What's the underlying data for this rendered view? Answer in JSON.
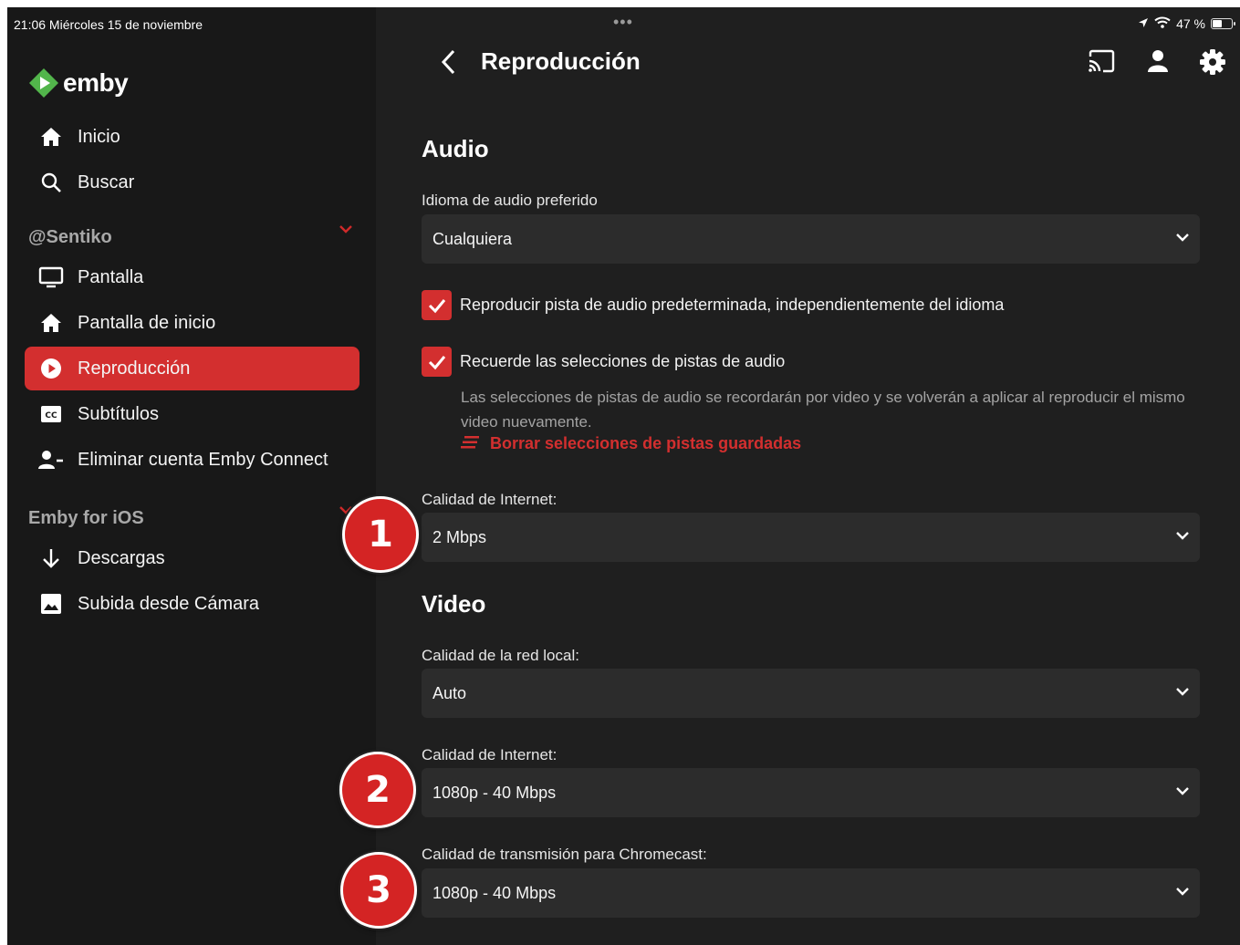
{
  "status_bar": {
    "time_date": "21:06  Miércoles 15 de noviembre",
    "dots": "•••",
    "battery": "47 %"
  },
  "sidebar": {
    "logo": "emby",
    "items_top": [
      {
        "label": "Inicio",
        "icon": "home-icon"
      },
      {
        "label": "Buscar",
        "icon": "search-icon"
      }
    ],
    "user_section": "@Sentiko",
    "user_items": [
      {
        "label": "Pantalla",
        "icon": "monitor-icon"
      },
      {
        "label": "Pantalla de inicio",
        "icon": "home-icon"
      },
      {
        "label": "Reproducción",
        "icon": "play-circle-icon",
        "active": true
      },
      {
        "label": "Subtítulos",
        "icon": "closed-caption-icon"
      },
      {
        "label": "Eliminar cuenta Emby Connect",
        "icon": "remove-user-icon"
      }
    ],
    "app_section": "Emby for iOS",
    "app_items": [
      {
        "label": "Descargas",
        "icon": "download-arrow-icon"
      },
      {
        "label": "Subida desde Cámara",
        "icon": "image-icon"
      }
    ]
  },
  "header": {
    "title": "Reproducción"
  },
  "audio": {
    "heading": "Audio",
    "language_label": "Idioma de audio preferido",
    "language_value": "Cualquiera",
    "play_default_label": "Reproducir pista de audio predeterminada, independientemente del idioma",
    "play_default_checked": true,
    "remember_label": "Recuerde las selecciones de pistas de audio",
    "remember_checked": true,
    "remember_help": "Las selecciones de pistas de audio se recordarán por video y se volverán a aplicar al reproducir el mismo video nuevamente.",
    "clear_link": "Borrar selecciones de pistas guardadas",
    "internet_label": "Calidad de Internet:",
    "internet_value": "2 Mbps"
  },
  "video": {
    "heading": "Video",
    "local_label": "Calidad de la red local:",
    "local_value": "Auto",
    "internet_label": "Calidad de Internet:",
    "internet_value": "1080p - 40 Mbps",
    "chromecast_label": "Calidad de transmisión para Chromecast:",
    "chromecast_value": "1080p - 40 Mbps"
  },
  "badges": [
    "1",
    "2",
    "3"
  ],
  "colors": {
    "accent": "#d32f2f",
    "background": "#1f1f1f",
    "sidebar": "#181818",
    "field": "#2c2c2c",
    "logo_green": "#52b54b"
  }
}
